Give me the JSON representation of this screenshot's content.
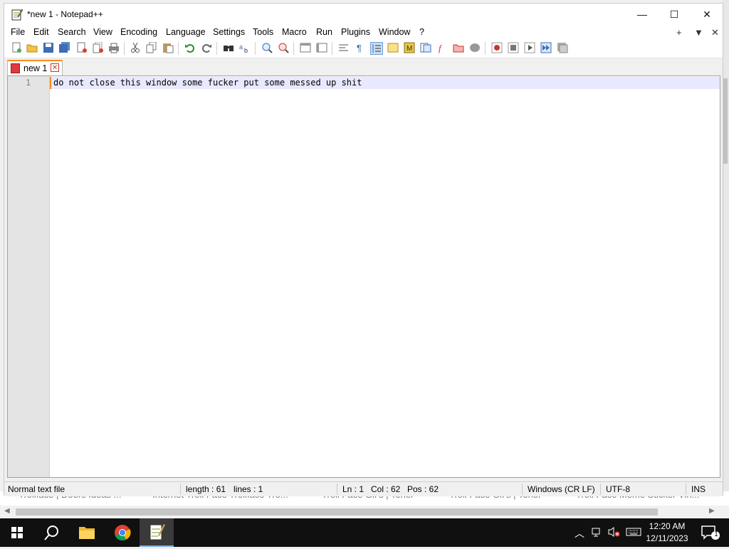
{
  "window": {
    "title": "*new 1 - Notepad++",
    "minimize_symbol": "—",
    "maximize_symbol": "☐",
    "close_symbol": "✕"
  },
  "menu": {
    "items": [
      "File",
      "Edit",
      "Search",
      "View",
      "Encoding",
      "Language",
      "Settings",
      "Tools",
      "Macro",
      "Run",
      "Plugins",
      "Window",
      "?"
    ],
    "right_icons": [
      "+",
      "▼",
      "✕"
    ]
  },
  "toolbar": {
    "icons": [
      "new-file-icon",
      "open-file-icon",
      "save-icon",
      "save-all-icon",
      "close-icon",
      "close-all-icon",
      "print-icon",
      "cut-icon",
      "copy-icon",
      "paste-icon",
      "undo-icon",
      "redo-icon",
      "find-icon",
      "replace-icon",
      "zoom-in-icon",
      "zoom-out-icon",
      "sync-vertical-icon",
      "sync-horizontal-icon",
      "word-wrap-icon",
      "show-all-characters-icon",
      "indent-guide-icon",
      "udl-icon",
      "document-map-icon",
      "document-list-icon",
      "function-list-icon",
      "folder-as-workspace-icon",
      "monitoring-icon",
      "record-macro-icon",
      "stop-recording-icon",
      "playback-macro-icon",
      "run-macro-multiple-icon",
      "save-macro-icon"
    ],
    "active_icon": "indent-guide-icon"
  },
  "tabs": [
    {
      "label": "new 1",
      "modified": true
    }
  ],
  "editor": {
    "line_numbers": [
      "1"
    ],
    "lines": [
      "do not close this window some fucker put some messed up shit"
    ]
  },
  "status": {
    "file_type": "Normal text file",
    "length": "length : 61",
    "lines": "lines : 1",
    "ln": "Ln : 1",
    "col": "Col : 62",
    "pos": "Pos : 62",
    "eol": "Windows (CR LF)",
    "encoding": "UTF-8",
    "mode": "INS"
  },
  "background_page": {
    "strip_items": [
      "Trollface | Doors Ideas ...",
      "Internet Troll Face Trollface Tro...",
      "Troll Face Gif's | Tenor",
      "Troll Face Gif's | Tenor",
      "Troll Face Meme Sticker Vin..."
    ]
  },
  "taskbar": {
    "time": "12:20 AM",
    "date": "12/11/2023",
    "notification_count": "1",
    "apps": [
      "start-icon",
      "search-icon",
      "file-explorer-icon",
      "chrome-icon",
      "notepadpp-icon"
    ]
  },
  "colors": {
    "tab_accent": "#fa8c1e",
    "current_line": "#e8e8ff",
    "taskbar": "#101010"
  }
}
